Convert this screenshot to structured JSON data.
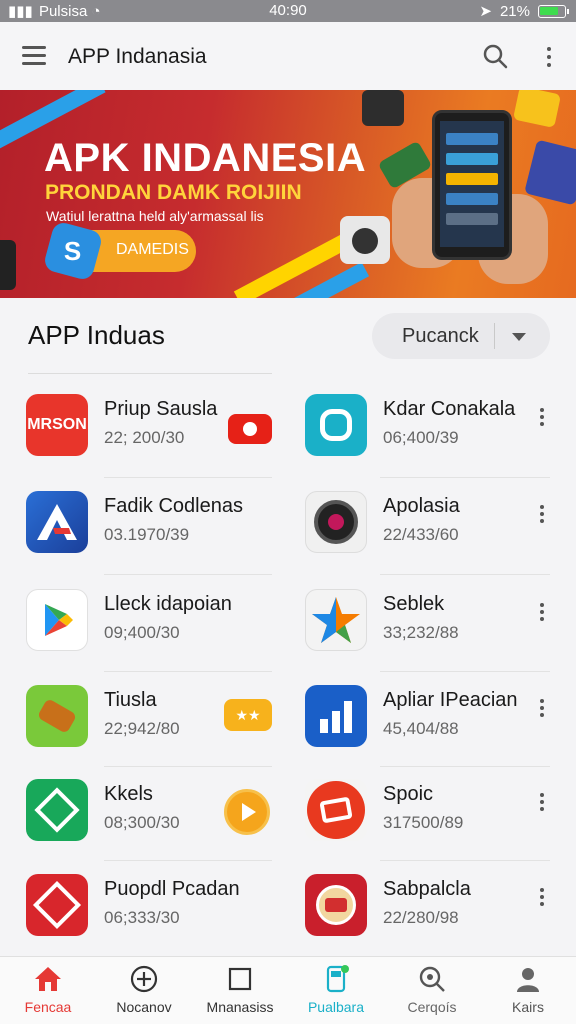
{
  "status_bar": {
    "carrier": "Pulsisa",
    "time": "40:90",
    "battery_text": "21%"
  },
  "app_bar": {
    "title": "APP Indanasia",
    "icons": [
      "menu-icon",
      "search-icon",
      "more-vert-icon"
    ]
  },
  "banner": {
    "headline": "APK INDANESIA",
    "subheadline": "PRONDAN DAMK ROIJIIN",
    "tagline": "Watiul lerattna held aly'armassal lis",
    "button_label": "DAMEDIS",
    "badge_glyph": "S"
  },
  "section": {
    "title": "APP Induas",
    "sort_selected": "Pucanck"
  },
  "apps": [
    {
      "name": "Priup Sausla",
      "meta": "22; 200/30",
      "icon_text": "MRSON",
      "action": "youtube-play-icon"
    },
    {
      "name": "Kdar Conakala",
      "meta": "06;400/39",
      "action": "more-vert-icon"
    },
    {
      "name": "Fadik Codlenas",
      "meta": "03.1970/39",
      "action": "none"
    },
    {
      "name": "Apolasia",
      "meta": "22/433/60",
      "action": "more-vert-icon"
    },
    {
      "name": "Lleck idapoian",
      "meta": "09;400/30",
      "action": "none"
    },
    {
      "name": "Seblek",
      "meta": "33;232/88",
      "action": "more-vert-icon"
    },
    {
      "name": "Tiusla",
      "meta": "22;942/80",
      "action": "badge-button"
    },
    {
      "name": "Apliar IPeacian",
      "meta": "45,404/88",
      "action": "more-vert-icon"
    },
    {
      "name": "Kkels",
      "meta": "08;300/30",
      "action": "play-circle-icon"
    },
    {
      "name": "Spoic",
      "meta": "317500/89",
      "action": "more-vert-icon"
    },
    {
      "name": "Puopdl Pcadan",
      "meta": "06;333/30",
      "action": "none"
    },
    {
      "name": "Sabpalcla",
      "meta": "22/280/98",
      "action": "more-vert-icon"
    }
  ],
  "bottom_nav": [
    {
      "label": "Fencaa",
      "icon": "home-icon",
      "active": true
    },
    {
      "label": "Nocanov",
      "icon": "add-circle-icon",
      "active": false
    },
    {
      "label": "Mnanasiss",
      "icon": "square-icon",
      "active": false
    },
    {
      "label": "Pualbara",
      "icon": "phone-badge-icon",
      "active": false
    },
    {
      "label": "Cerqoís",
      "icon": "search-icon",
      "active": false
    },
    {
      "label": "Kairs",
      "icon": "profile-icon",
      "active": false
    }
  ],
  "colors": {
    "accent_red": "#e53935",
    "accent_teal": "#1ab0c8",
    "banner_red": "#c62c2e",
    "banner_orange": "#ea7b22"
  }
}
